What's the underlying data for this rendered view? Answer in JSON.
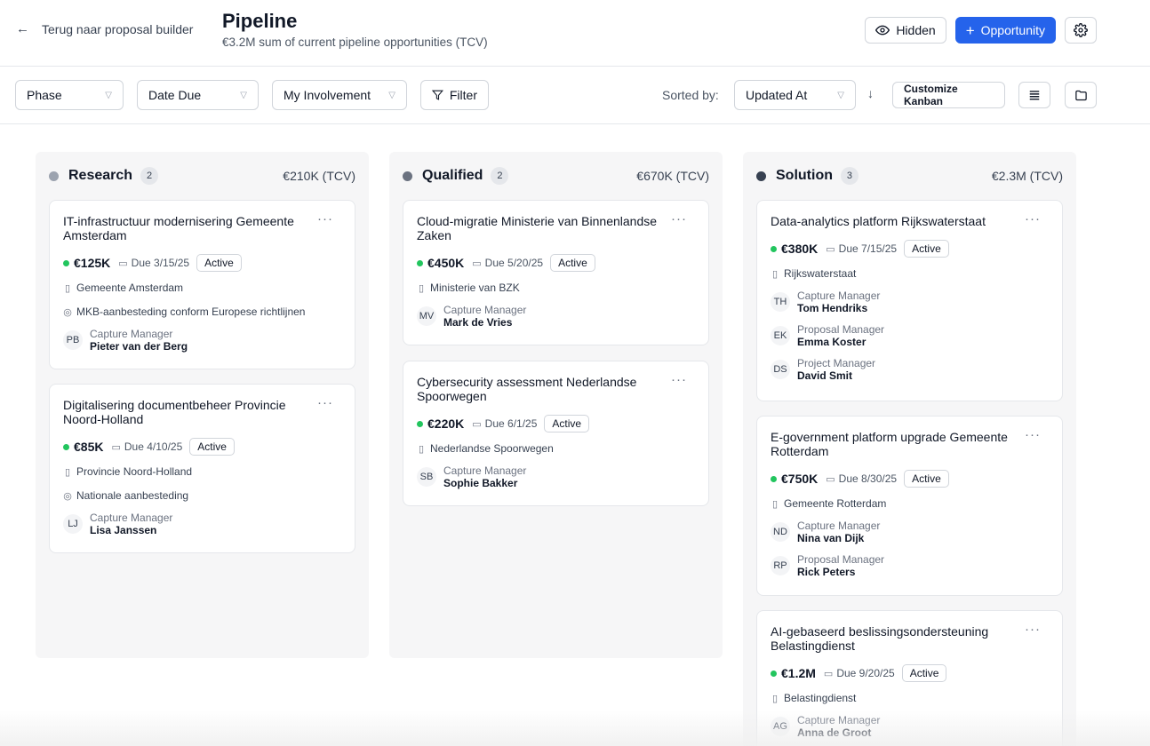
{
  "header": {
    "back_label": "Terug naar proposal builder",
    "title": "Pipeline",
    "subtitle": "€3.2M sum of current pipeline opportunities (TCV)",
    "hidden_label": "Hidden",
    "opportunity_label": "Opportunity"
  },
  "filters": {
    "phase": "Phase",
    "date_due": "Date Due",
    "involvement": "My Involvement",
    "filter": "Filter",
    "sorted_by_label": "Sorted by:",
    "sort_value": "Updated At",
    "customize": "Customize Kanban"
  },
  "colors": {
    "accent": "#2563eb",
    "active_dot": "#22c55e"
  },
  "columns": [
    {
      "name": "Research",
      "count": "2",
      "total": "€210K (TCV)",
      "dot_color": "#9ca3af",
      "cards": [
        {
          "title": "IT-infrastructuur modernisering Gemeente Amsterdam",
          "value": "€125K",
          "due": "Due 3/15/25",
          "status": "Active",
          "org": "Gemeente Amsterdam",
          "procurement": "MKB-aanbesteding conform Europese richtlijnen",
          "people": [
            {
              "initials": "PB",
              "role": "Capture Manager",
              "name": "Pieter van der Berg"
            }
          ]
        },
        {
          "title": "Digitalisering documentbeheer Provincie Noord-Holland",
          "value": "€85K",
          "due": "Due 4/10/25",
          "status": "Active",
          "org": "Provincie Noord-Holland",
          "procurement": "Nationale aanbesteding",
          "people": [
            {
              "initials": "LJ",
              "role": "Capture Manager",
              "name": "Lisa Janssen"
            }
          ]
        }
      ]
    },
    {
      "name": "Qualified",
      "count": "2",
      "total": "€670K (TCV)",
      "dot_color": "#6b7280",
      "cards": [
        {
          "title": "Cloud-migratie Ministerie van Binnenlandse Zaken",
          "value": "€450K",
          "due": "Due 5/20/25",
          "status": "Active",
          "org": "Ministerie van BZK",
          "people": [
            {
              "initials": "MV",
              "role": "Capture Manager",
              "name": "Mark de Vries"
            }
          ]
        },
        {
          "title": "Cybersecurity assessment Nederlandse Spoorwegen",
          "value": "€220K",
          "due": "Due 6/1/25",
          "status": "Active",
          "org": "Nederlandse Spoorwegen",
          "people": [
            {
              "initials": "SB",
              "role": "Capture Manager",
              "name": "Sophie Bakker"
            }
          ]
        }
      ]
    },
    {
      "name": "Solution",
      "count": "3",
      "total": "€2.3M (TCV)",
      "dot_color": "#374151",
      "cards": [
        {
          "title": "Data-analytics platform Rijkswaterstaat",
          "value": "€380K",
          "due": "Due 7/15/25",
          "status": "Active",
          "org": "Rijkswaterstaat",
          "people": [
            {
              "initials": "TH",
              "role": "Capture Manager",
              "name": "Tom Hendriks"
            },
            {
              "initials": "EK",
              "role": "Proposal Manager",
              "name": "Emma Koster"
            },
            {
              "initials": "DS",
              "role": "Project Manager",
              "name": "David Smit"
            }
          ]
        },
        {
          "title": "E-government platform upgrade Gemeente Rotterdam",
          "value": "€750K",
          "due": "Due 8/30/25",
          "status": "Active",
          "org": "Gemeente Rotterdam",
          "people": [
            {
              "initials": "ND",
              "role": "Capture Manager",
              "name": "Nina van Dijk"
            },
            {
              "initials": "RP",
              "role": "Proposal Manager",
              "name": "Rick Peters"
            }
          ]
        },
        {
          "title": "AI-gebaseerd beslissingsondersteuning Belastingdienst",
          "value": "€1.2M",
          "due": "Due 9/20/25",
          "status": "Active",
          "org": "Belastingdienst",
          "people": [
            {
              "initials": "AG",
              "role": "Capture Manager",
              "name": "Anna de Groot"
            }
          ]
        }
      ]
    }
  ]
}
